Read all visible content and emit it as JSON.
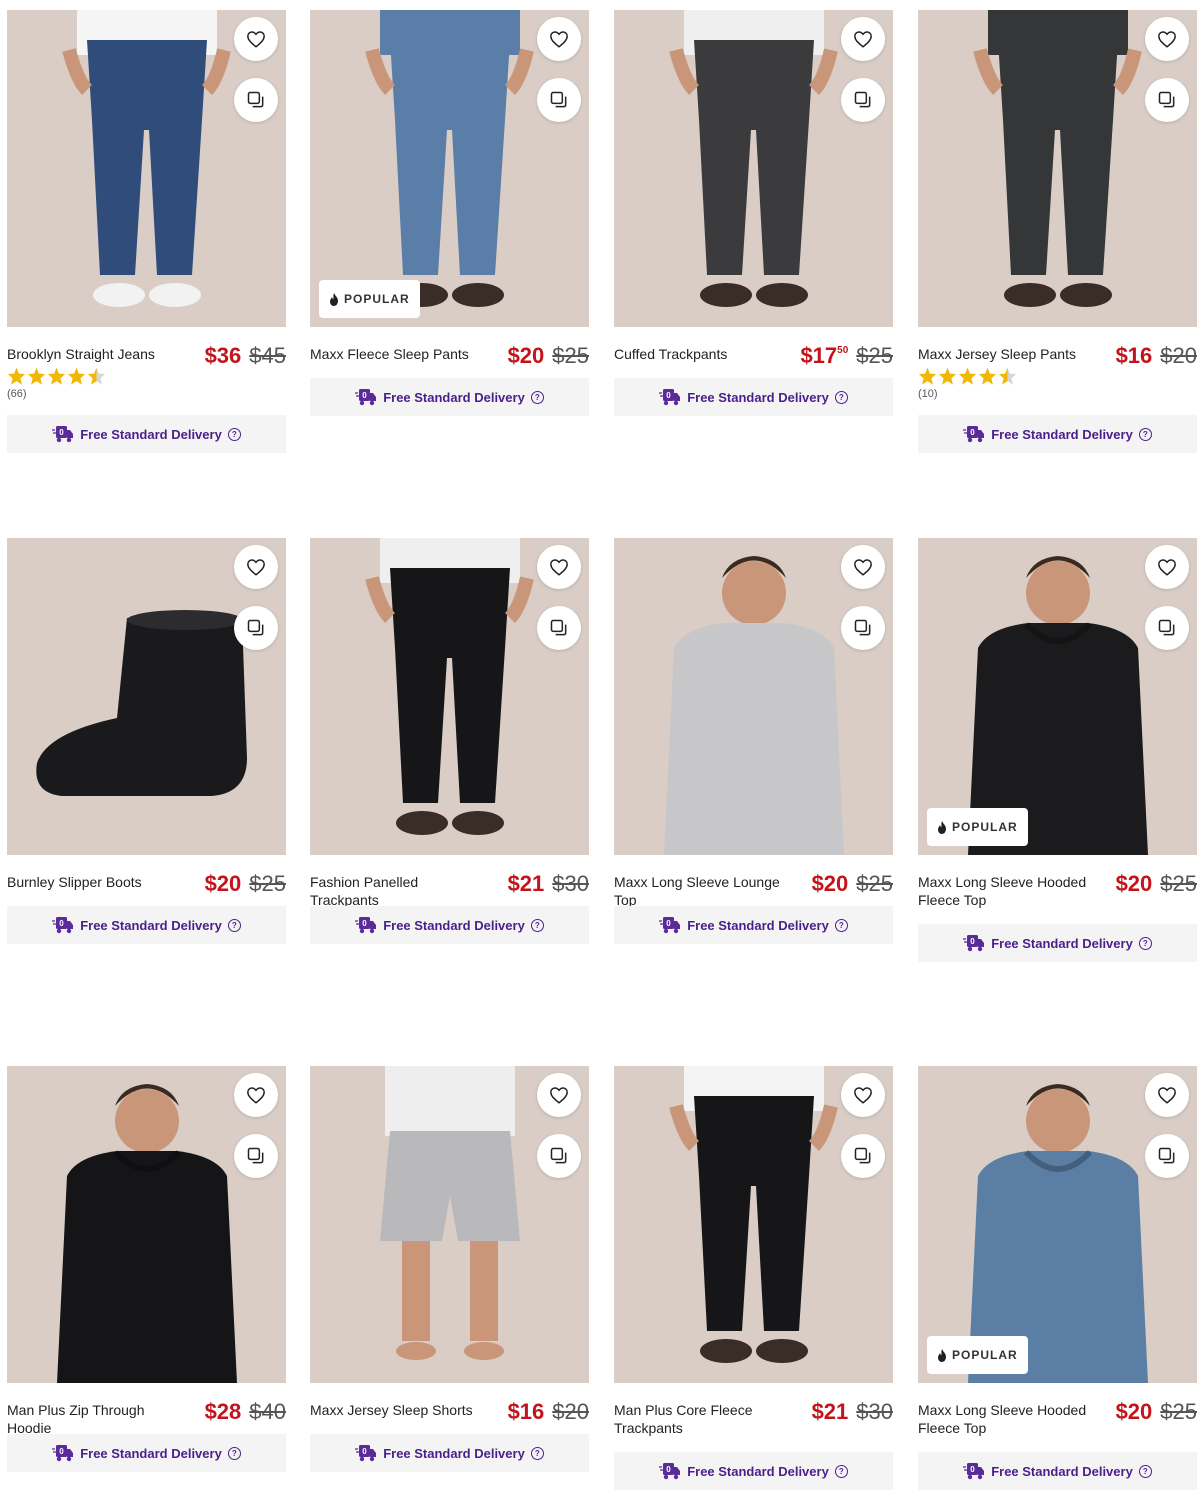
{
  "colors": {
    "price": "#c4131b",
    "delivery_text": "#4b1f8b",
    "delivery_bg": "#f4f4f4",
    "star": "#f2b705",
    "image_bg": "#d9cdc6"
  },
  "icons": {
    "wishlist": "heart-icon",
    "compare": "compare-icon",
    "popular": "flame-icon",
    "delivery": "delivery-truck-icon",
    "help": "help-circle-icon"
  },
  "delivery_label": "Free Standard Delivery",
  "products": [
    {
      "name": "Brooklyn Straight Jeans",
      "price": "$36",
      "cents": "",
      "was": "$45",
      "badge": "",
      "rating": 4.5,
      "reviews": "(66)",
      "subject": "jeans",
      "garment": "#2f4c7a",
      "top": "#f5f5f5"
    },
    {
      "name": "Maxx Fleece Sleep Pants",
      "price": "$20",
      "cents": "",
      "was": "$25",
      "badge": "POPULAR",
      "rating": null,
      "reviews": "",
      "subject": "pants",
      "garment": "#5a7ea8",
      "top": "#5a7ea8"
    },
    {
      "name": "Cuffed Trackpants",
      "price": "$17",
      "cents": "50",
      "was": "$25",
      "badge": "",
      "rating": null,
      "reviews": "",
      "subject": "pants",
      "garment": "#3b3b3d",
      "top": "#efefef"
    },
    {
      "name": "Maxx Jersey Sleep Pants",
      "price": "$16",
      "cents": "",
      "was": "$20",
      "badge": "",
      "rating": 4.5,
      "reviews": "(10)",
      "subject": "pants",
      "garment": "#343638",
      "top": "#343638"
    },
    {
      "name": "Burnley Slipper Boots",
      "price": "$20",
      "cents": "",
      "was": "$25",
      "badge": "",
      "rating": null,
      "reviews": "",
      "subject": "boot",
      "garment": "#1a1a1c",
      "top": ""
    },
    {
      "name": "Fashion Panelled Trackpants",
      "price": "$21",
      "cents": "",
      "was": "$30",
      "badge": "",
      "rating": null,
      "reviews": "",
      "subject": "pants",
      "garment": "#161618",
      "top": "#efefef"
    },
    {
      "name": "Maxx Long Sleeve Lounge Top",
      "price": "$20",
      "cents": "",
      "was": "$25",
      "badge": "",
      "rating": null,
      "reviews": "",
      "subject": "top",
      "garment": "#c7c7c9",
      "top": ""
    },
    {
      "name": "Maxx Long Sleeve Hooded Fleece Top",
      "price": "$20",
      "cents": "",
      "was": "$25",
      "badge": "POPULAR",
      "rating": null,
      "reviews": "",
      "subject": "hoodie",
      "garment": "#1b1b1d",
      "top": ""
    },
    {
      "name": "Man Plus Zip Through Hoodie",
      "price": "$28",
      "cents": "",
      "was": "$40",
      "badge": "",
      "rating": null,
      "reviews": "",
      "subject": "hoodie",
      "garment": "#151517",
      "top": ""
    },
    {
      "name": "Maxx Jersey Sleep Shorts",
      "price": "$16",
      "cents": "",
      "was": "$20",
      "badge": "",
      "rating": null,
      "reviews": "",
      "subject": "shorts",
      "garment": "#b9b9bb",
      "top": "#eeeeee"
    },
    {
      "name": "Man Plus Core Fleece Trackpants",
      "price": "$21",
      "cents": "",
      "was": "$30",
      "badge": "",
      "rating": null,
      "reviews": "",
      "subject": "pants",
      "garment": "#161618",
      "top": "#f3f3f3"
    },
    {
      "name": "Maxx Long Sleeve Hooded Fleece Top",
      "price": "$20",
      "cents": "",
      "was": "$25",
      "badge": "POPULAR",
      "rating": null,
      "reviews": "",
      "subject": "hoodie",
      "garment": "#5b7fa4",
      "top": ""
    }
  ]
}
